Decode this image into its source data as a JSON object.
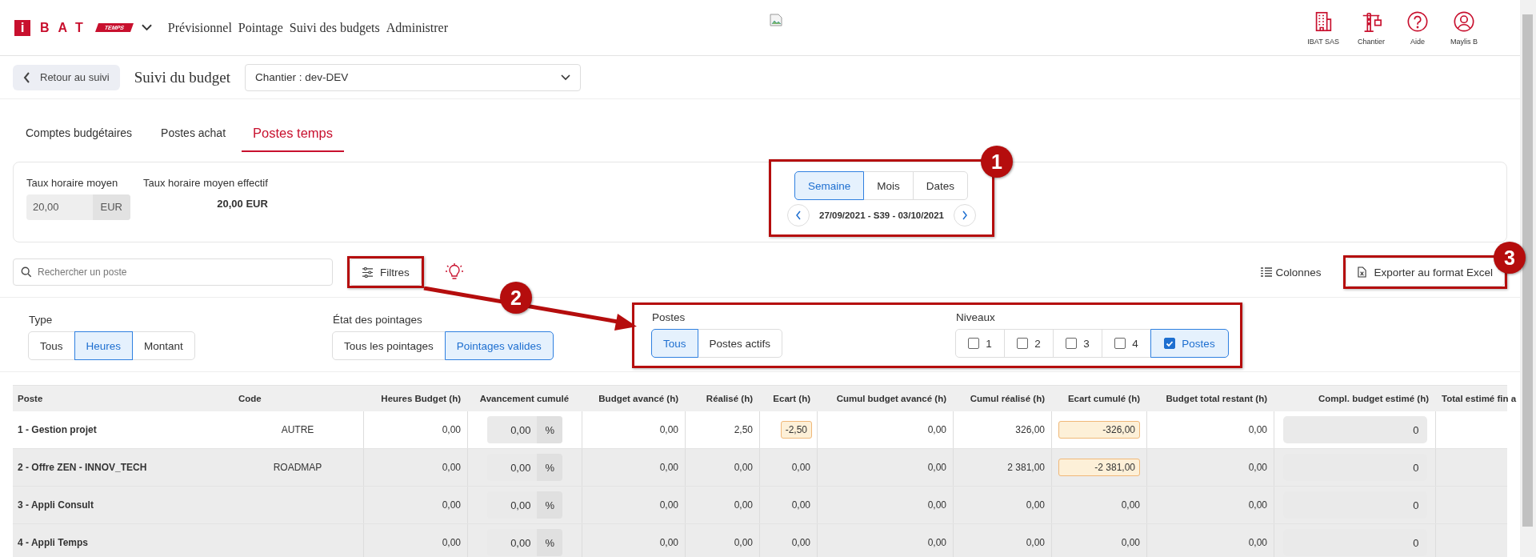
{
  "logo": {
    "mark": "i",
    "name": "BAT",
    "badge": "TEMPS"
  },
  "nav": [
    "Prévisionnel",
    "Pointage",
    "Suivi des budgets",
    "Administrer"
  ],
  "header_actions": [
    {
      "kind": "building",
      "label": "IBAT SAS"
    },
    {
      "kind": "crane",
      "label": "Chantier"
    },
    {
      "kind": "help",
      "label": "Aide"
    },
    {
      "kind": "user",
      "label": "Maylis B"
    }
  ],
  "back_button": "Retour au suivi",
  "page_title": "Suivi du budget",
  "site_select": "Chantier : dev-DEV",
  "tabs": [
    {
      "label": "Comptes budgétaires",
      "selected": false
    },
    {
      "label": "Postes achat",
      "selected": false
    },
    {
      "label": "Postes temps",
      "selected": true
    }
  ],
  "rates": {
    "label": "Taux horaire moyen",
    "value": "20,00",
    "unit": "EUR",
    "effective_label": "Taux horaire moyen effectif",
    "effective_value": "20,00 EUR"
  },
  "period": {
    "modes": [
      {
        "label": "Semaine",
        "selected": true
      },
      {
        "label": "Mois",
        "selected": false
      },
      {
        "label": "Dates",
        "selected": false
      }
    ],
    "range": "27/09/2021 - S39 - 03/10/2021"
  },
  "search": {
    "placeholder": "Rechercher un poste"
  },
  "filters_button": "Filtres",
  "columns_button": "Colonnes",
  "export_button": "Exporter au format Excel",
  "filters": {
    "type": {
      "label": "Type",
      "options": [
        {
          "label": "Tous",
          "selected": false
        },
        {
          "label": "Heures",
          "selected": true
        },
        {
          "label": "Montant",
          "selected": false
        }
      ]
    },
    "state": {
      "label": "État des pointages",
      "options": [
        {
          "label": "Tous les pointages",
          "selected": false
        },
        {
          "label": "Pointages valides",
          "selected": true
        }
      ]
    },
    "postes": {
      "label": "Postes",
      "options": [
        {
          "label": "Tous",
          "selected": true
        },
        {
          "label": "Postes actifs",
          "selected": false
        }
      ]
    },
    "levels": {
      "label": "Niveaux",
      "options": [
        {
          "label": "1",
          "checked": false
        },
        {
          "label": "2",
          "checked": false
        },
        {
          "label": "3",
          "checked": false
        },
        {
          "label": "4",
          "checked": false
        },
        {
          "label": "Postes",
          "checked": true
        }
      ]
    }
  },
  "annotations": [
    {
      "number": "1"
    },
    {
      "number": "2"
    },
    {
      "number": "3"
    }
  ],
  "table": {
    "columns": [
      "Poste",
      "Code",
      "Heures Budget (h)",
      "Avancement cumulé",
      "Budget avancé (h)",
      "Réalisé (h)",
      "Ecart (h)",
      "Cumul budget avancé (h)",
      "Cumul réalisé (h)",
      "Ecart cumulé (h)",
      "Budget total restant (h)",
      "Compl. budget estimé (h)",
      "Total estimé fin a"
    ],
    "rows": [
      {
        "selected": true,
        "poste": "1 - Gestion projet",
        "code": "AUTRE",
        "heures_budget": "0,00",
        "avancement": "0,00",
        "avancement_unit": "%",
        "budget_avance": "0,00",
        "realise": "2,50",
        "ecart": {
          "value": "-2,50",
          "warning": true
        },
        "cumul_budget_avance": "0,00",
        "cumul_realise": "326,00",
        "ecart_cumule": {
          "value": "-326,00",
          "warning": true
        },
        "budget_total_restant": "0,00",
        "compl_budget_estime": "0"
      },
      {
        "selected": false,
        "poste": "2 - Offre ZEN - INNOV_TECH",
        "code": "ROADMAP",
        "heures_budget": "0,00",
        "avancement": "0,00",
        "avancement_unit": "%",
        "budget_avance": "0,00",
        "realise": "0,00",
        "ecart": {
          "value": "0,00",
          "warning": false
        },
        "cumul_budget_avance": "0,00",
        "cumul_realise": "2 381,00",
        "ecart_cumule": {
          "value": "-2 381,00",
          "warning": true
        },
        "budget_total_restant": "0,00",
        "compl_budget_estime": "0"
      },
      {
        "selected": false,
        "poste": "3 - Appli Consult",
        "heures_budget": "0,00",
        "avancement": "0,00",
        "avancement_unit": "%",
        "budget_avance": "0,00",
        "realise": "0,00",
        "ecart": {
          "value": "0,00",
          "warning": false
        },
        "cumul_budget_avance": "0,00",
        "cumul_realise": "0,00",
        "ecart_cumule": {
          "value": "0,00",
          "warning": false
        },
        "budget_total_restant": "0,00",
        "compl_budget_estime": "0"
      },
      {
        "selected": false,
        "poste": "4 - Appli Temps",
        "heures_budget": "0,00",
        "avancement": "0,00",
        "avancement_unit": "%",
        "budget_avance": "0,00",
        "realise": "0,00",
        "ecart": {
          "value": "0,00",
          "warning": false
        },
        "cumul_budget_avance": "0,00",
        "cumul_realise": "0,00",
        "ecart_cumule": {
          "value": "0,00",
          "warning": false
        },
        "budget_total_restant": "0,00",
        "compl_budget_estime": "0"
      }
    ]
  }
}
